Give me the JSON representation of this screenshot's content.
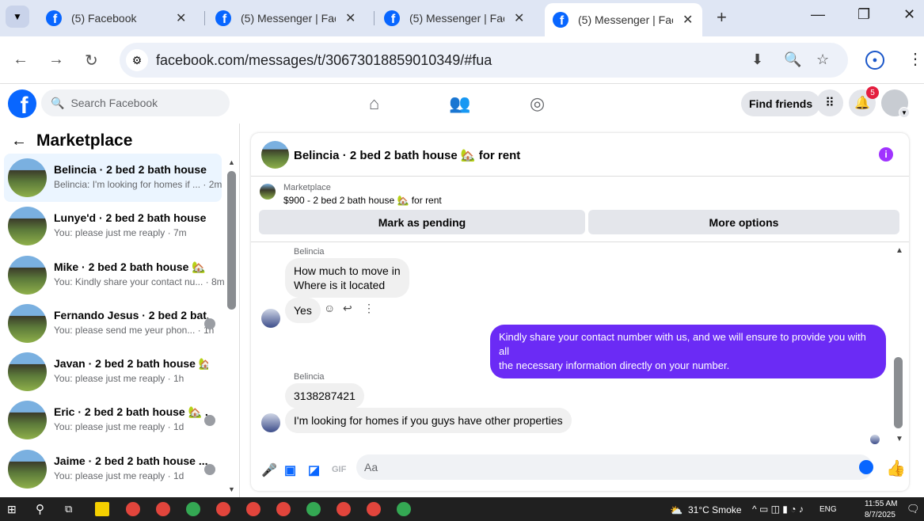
{
  "browser": {
    "tabs": [
      {
        "title": "(5) Facebook",
        "active": false
      },
      {
        "title": "(5) Messenger | Facebook",
        "active": false
      },
      {
        "title": "(5) Messenger | Facebook",
        "active": false
      },
      {
        "title": "(5) Messenger | Facebook",
        "active": true
      }
    ],
    "new_tab": "+",
    "url": "facebook.com/messages/t/30673018859010349/#fua"
  },
  "fb": {
    "search_placeholder": "Search Facebook",
    "find_friends": "Find friends",
    "notif_count": "5"
  },
  "sidebar": {
    "title": "Marketplace",
    "conversations": [
      {
        "name": "Belincia · 2 bed 2 bath house ...",
        "snippet": "Belincia: I'm looking for homes if ... · 2m",
        "selected": true
      },
      {
        "name": "Lunye'd · 2 bed 2 bath house ...",
        "snippet": "You: please just me reaply · 7m"
      },
      {
        "name": "Mike · 2 bed 2 bath house 🏡 f...",
        "snippet": "You: Kindly share your contact nu... · 8m"
      },
      {
        "name": "Fernando Jesus · 2 bed 2 bat...",
        "snippet": "You: please send me yeur phon... · 1h"
      },
      {
        "name": "Javan · 2 bed 2 bath house 🏡 f...",
        "snippet": "You: please just me reaply · 1h"
      },
      {
        "name": "Eric · 2 bed 2 bath house 🏡 ...",
        "snippet": "You: please just me reaply · 1d"
      },
      {
        "name": "Jaime · 2 bed 2 bath house ...",
        "snippet": "You: please just me reaply · 1d"
      }
    ]
  },
  "chat": {
    "title": "Belincia · 2 bed 2 bath house 🏡 for rent",
    "listing_label": "Marketplace",
    "listing_text": "$900 - 2 bed 2 bath house 🏡 for rent",
    "mark_pending": "Mark as pending",
    "more_options": "More options",
    "sender1": "Belincia",
    "msg1_line1": "How much to move in",
    "msg1_line2": "Where is it located",
    "msg2": "Yes",
    "out_msg_line1": "Kindly share your contact number with us, and we will ensure to provide you with all",
    "out_msg_line2": "the necessary information directly on your number.",
    "sender2": "Belincia",
    "msg3": "3138287421",
    "msg4": "I'm looking for homes if you guys have other properties",
    "compose_placeholder": "Aa",
    "gif_label": "GIF"
  },
  "taskbar": {
    "weather": "31°C  Smoke",
    "lang": "ENG",
    "time": "11:55 AM",
    "date": "8/7/2025"
  },
  "colors": {
    "accent": "#0866ff",
    "outgoing_bubble": "#6b2bf5",
    "selected_conv": "#ebf5ff"
  }
}
